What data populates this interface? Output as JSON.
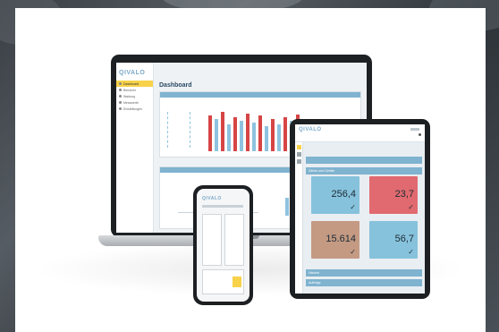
{
  "colors": {
    "accent": "#7fb3cf",
    "highlight": "#f7d24a",
    "bar_red": "#d64545",
    "bar_blue": "#8fc3df",
    "tile_blue": "#86c2dc",
    "tile_red": "#e06a6f",
    "tile_tan": "#c49a83"
  },
  "laptop": {
    "brand": "QIVALO",
    "title": "Dashboard",
    "nav": [
      {
        "label": "Dashboard"
      },
      {
        "label": "Benutzer"
      },
      {
        "label": "Wartung"
      },
      {
        "label": "Messwerte"
      },
      {
        "label": "Einstellungen"
      }
    ]
  },
  "tablet": {
    "brand": "QIVALO",
    "section": "Zähler und Geräte",
    "footer_bar_1": "Historie",
    "footer_bar_2": "Aufträge",
    "tiles": [
      {
        "value": "256,4",
        "color": "tile_blue"
      },
      {
        "value": "23,7",
        "color": "tile_red"
      },
      {
        "value": "15.614",
        "color": "tile_tan"
      },
      {
        "value": "56,7",
        "color": "tile_blue"
      }
    ]
  },
  "phone": {
    "brand": "QIVALO"
  }
}
